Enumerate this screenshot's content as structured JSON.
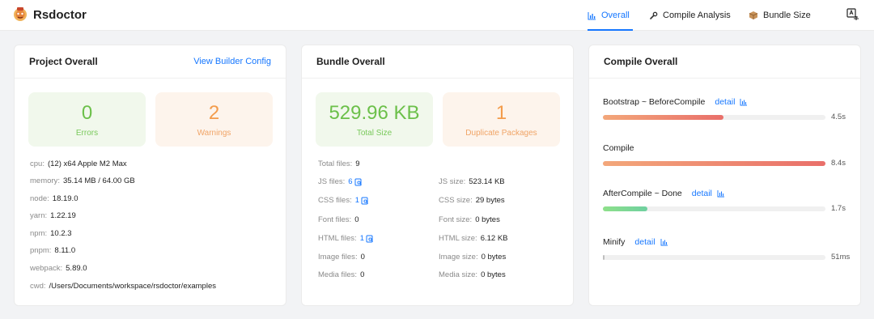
{
  "app": {
    "title": "Rsdoctor"
  },
  "nav": {
    "overall": "Overall",
    "compile": "Compile Analysis",
    "bundle": "Bundle Size"
  },
  "project": {
    "title": "Project Overall",
    "link": "View Builder Config",
    "errors": {
      "value": "0",
      "label": "Errors"
    },
    "warnings": {
      "value": "2",
      "label": "Warnings"
    },
    "env": [
      {
        "key": "cpu",
        "value": "(12) x64 Apple M2 Max"
      },
      {
        "key": "memory",
        "value": "35.14 MB / 64.00 GB"
      },
      {
        "key": "node",
        "value": "18.19.0"
      },
      {
        "key": "yarn",
        "value": "1.22.19"
      },
      {
        "key": "npm",
        "value": "10.2.3"
      },
      {
        "key": "pnpm",
        "value": "8.11.0"
      },
      {
        "key": "webpack",
        "value": "5.89.0"
      },
      {
        "key": "cwd",
        "value": "/Users/Documents/workspace/rsdoctor/examples"
      }
    ]
  },
  "bundle": {
    "title": "Bundle Overall",
    "total_size": {
      "value": "529.96 KB",
      "label": "Total Size"
    },
    "duplicates": {
      "value": "1",
      "label": "Duplicate Packages"
    },
    "total_files": {
      "key": "Total files",
      "value": "9"
    },
    "files": [
      {
        "key": "JS files",
        "value": "6"
      },
      {
        "key": "CSS files",
        "value": "1"
      },
      {
        "key": "Font files",
        "value": "0"
      },
      {
        "key": "HTML files",
        "value": "1"
      },
      {
        "key": "Image files",
        "value": "0"
      },
      {
        "key": "Media files",
        "value": "0"
      }
    ],
    "sizes": [
      {
        "key": "JS size",
        "value": "523.14 KB"
      },
      {
        "key": "CSS size",
        "value": "29 bytes"
      },
      {
        "key": "Font size",
        "value": "0 bytes"
      },
      {
        "key": "HTML size",
        "value": "6.12 KB"
      },
      {
        "key": "Image size",
        "value": "0 bytes"
      },
      {
        "key": "Media size",
        "value": "0 bytes"
      }
    ]
  },
  "compile": {
    "title": "Compile Overall",
    "phases": [
      {
        "name": "Bootstrap ~ BeforeCompile",
        "detail": "detail",
        "time": "4.5s",
        "fraction": 0.54,
        "color": "#e96f6a"
      },
      {
        "name": "Compile",
        "detail": "",
        "time": "8.4s",
        "fraction": 1.0,
        "color": "#e96f6a"
      },
      {
        "name": "AfterCompile ~ Done",
        "detail": "detail",
        "time": "1.7s",
        "fraction": 0.2,
        "color": "#7fd98a"
      },
      {
        "name": "Minify",
        "detail": "detail",
        "time": "51ms",
        "fraction": 0.006,
        "color": "#bfbfbf"
      }
    ]
  },
  "colors": {
    "accent": "#1677ff",
    "success": "#6cc04a",
    "warning": "#f39c4c"
  }
}
